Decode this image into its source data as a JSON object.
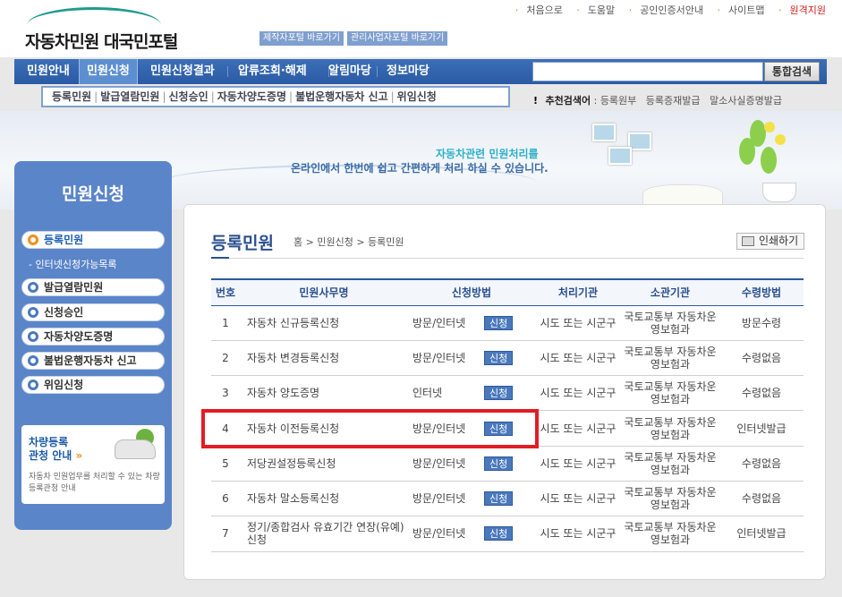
{
  "header": {
    "logo_text": "자동차민원 대국민포털",
    "util_links": [
      "처음으로",
      "도움말",
      "공인인증서안내",
      "사이트맵",
      "원격지원"
    ],
    "shortcuts": [
      "제작자포털 바로가기",
      "관리사업자포털 바로가기"
    ]
  },
  "gnb": {
    "items": [
      "민원안내",
      "민원신청",
      "민원신청결과",
      "압류조회·해제",
      "알림마당",
      "정보마당"
    ],
    "active_index": 1,
    "search_placeholder": "",
    "search_button": "통합검색"
  },
  "subnav": {
    "items": [
      "등록민원",
      "발급열람민원",
      "신청승인",
      "자동차양도증명",
      "불법운행자동차 신고",
      "위임신청"
    ]
  },
  "recommend": {
    "label": "추천검색어",
    "keywords": [
      "등록원부",
      "등록증재발급",
      "말소사실증명발급"
    ]
  },
  "banner": {
    "line1": "자동차관련 민원처리를",
    "line2": "온라인에서 한번에 쉽고 간편하게 처리 하실 수 있습니다."
  },
  "lnb": {
    "title": "민원신청",
    "items": [
      "등록민원",
      "발급열람민원",
      "신청승인",
      "자동차양도증명",
      "불법운행자동차 신고",
      "위임신청"
    ],
    "sub_item": "인터넷신청가능목록",
    "promo_title_1": "차량등록",
    "promo_title_2": "관청 안내",
    "promo_desc": "자동차 민원업무를 처리할 수 있는 차량등록관청 안내"
  },
  "content": {
    "title": "등록민원",
    "breadcrumb": [
      "홈",
      "민원신청",
      "등록민원"
    ],
    "print_button": "인쇄하기",
    "table": {
      "headers": [
        "번호",
        "민원사무명",
        "신청방법",
        "처리기관",
        "소관기관",
        "수령방법"
      ],
      "apply_label": "신청",
      "rows": [
        {
          "num": "1",
          "name": "자동차 신규등록신청",
          "method": "방문/인터넷",
          "handler": "시도 또는 시군구",
          "owner": "국토교통부 자동차운영보험과",
          "receive": "방문수령"
        },
        {
          "num": "2",
          "name": "자동차 변경등록신청",
          "method": "방문/인터넷",
          "handler": "시도 또는 시군구",
          "owner": "국토교통부 자동차운영보험과",
          "receive": "수령없음"
        },
        {
          "num": "3",
          "name": "자동차 양도증명",
          "method": "인터넷",
          "handler": "시도 또는 시군구",
          "owner": "국토교통부 자동차운영보험과",
          "receive": "수령없음"
        },
        {
          "num": "4",
          "name": "자동차 이전등록신청",
          "method": "방문/인터넷",
          "handler": "시도 또는 시군구",
          "owner": "국토교통부 자동차운영보험과",
          "receive": "인터넷발급"
        },
        {
          "num": "5",
          "name": "저당권설정등록신청",
          "method": "방문/인터넷",
          "handler": "시도 또는 시군구",
          "owner": "국토교통부 자동차운영보험과",
          "receive": "수령없음"
        },
        {
          "num": "6",
          "name": "자동차 말소등록신청",
          "method": "방문/인터넷",
          "handler": "시도 또는 시군구",
          "owner": "국토교통부 자동차운영보험과",
          "receive": "수령없음"
        },
        {
          "num": "7",
          "name": "정기/종합검사 유효기간 연장(유예)신청",
          "method": "방문/인터넷",
          "handler": "시도 또는 시군구",
          "owner": "국토교통부 자동차운영보험과",
          "receive": "인터넷발급"
        }
      ]
    }
  },
  "colors": {
    "brand_blue": "#2a5aa3",
    "highlight_red": "#e31c23",
    "accent_orange": "#f08f1f"
  }
}
